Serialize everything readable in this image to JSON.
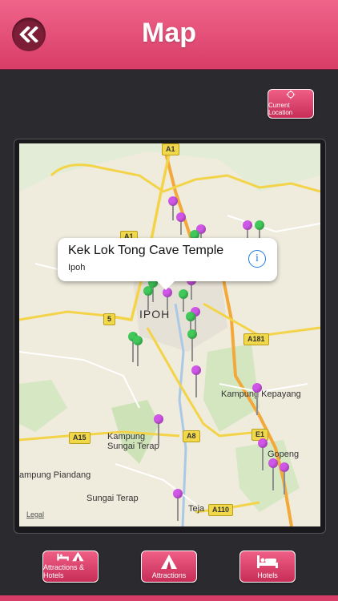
{
  "header": {
    "title": "Map",
    "back_icon": "double-chevron-left-icon"
  },
  "current_location": {
    "label": "Current Location",
    "icon": "crosshair-icon"
  },
  "map": {
    "callout": {
      "title": "Kek Lok Tong Cave Temple",
      "subtitle": "Ipoh"
    },
    "places": {
      "ipoh": "IPOH",
      "kampung_kepayang": "Kampung Kepayang",
      "kampung_sungai_terap_1": "Kampung",
      "kampung_sungai_terap_2": "Sungai Terap",
      "gopeng": "Gopeng",
      "kampung_piandang": "ampung Piandang",
      "sungai_terap": "Sungai Terap",
      "teja": "Teja"
    },
    "roads": {
      "a1_top": "A1",
      "a1_mid": "A1",
      "r5": "5",
      "a181": "A181",
      "a15": "A15",
      "a8": "A8",
      "e1": "E1",
      "a110": "A110"
    },
    "legal": "Legal",
    "pin_colors": {
      "attraction": "#cf56e6",
      "hotel": "#41c85a"
    }
  },
  "tabs": [
    {
      "label": "Attractions & Hotels",
      "icon": "bed-and-tent-icon"
    },
    {
      "label": "Attractions",
      "icon": "tent-icon"
    },
    {
      "label": "Hotels",
      "icon": "bed-icon"
    }
  ],
  "colors": {
    "accent": "#d83d67",
    "background": "#2b2b2f"
  }
}
